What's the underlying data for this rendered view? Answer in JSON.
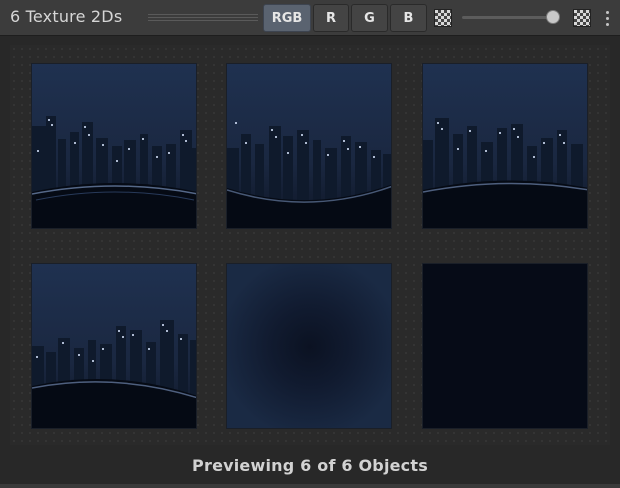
{
  "window": {
    "title": "6 Texture 2Ds"
  },
  "toolbar": {
    "channels": [
      "RGB",
      "R",
      "G",
      "B"
    ],
    "active_channel": "RGB",
    "alpha_slider": {
      "value": 0.95,
      "low_icon": "checker-small-icon",
      "high_icon": "checker-large-icon"
    },
    "menu_icon": "kebab-menu-icon"
  },
  "preview": {
    "thumbnails": [
      {
        "name": "city-night-texture",
        "variant": "city"
      },
      {
        "name": "city-night-texture",
        "variant": "city"
      },
      {
        "name": "city-night-texture",
        "variant": "city"
      },
      {
        "name": "city-night-texture",
        "variant": "city"
      },
      {
        "name": "dark-vignette-texture",
        "variant": "vignette"
      },
      {
        "name": "solid-dark-texture",
        "variant": "solid"
      }
    ],
    "status": "Previewing 6 of 6 Objects"
  },
  "colors": {
    "background": "#282828",
    "toolbar": "#3c3c3c",
    "active_button": "#5a6370",
    "sky": "#1e2c45",
    "solid_texture": "#060b17"
  }
}
